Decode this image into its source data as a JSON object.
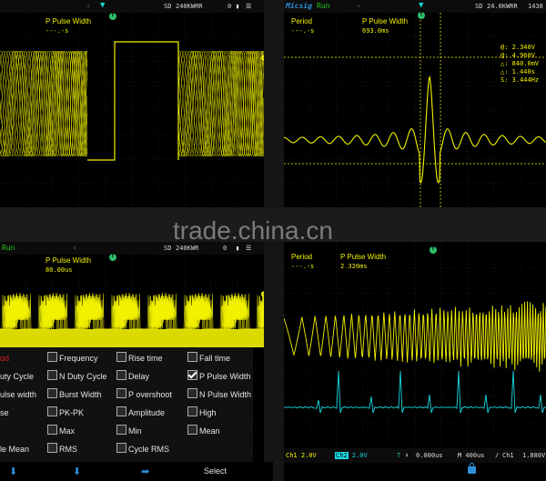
{
  "watermark": "trade.china.cn",
  "tl": {
    "topbar": {
      "sd": "SD",
      "mem": "240K",
      "mode": "WRR",
      "num": "0"
    },
    "meas": {
      "label": "P Pulse Width",
      "value": "---.-s"
    }
  },
  "tr": {
    "topbar": {
      "brand": "Micsig",
      "status": "Run",
      "sd": "SD",
      "rate": "24.0KWRR",
      "num": "1438"
    },
    "meas1": {
      "label": "Period",
      "value": "---.-s"
    },
    "meas2": {
      "label": "P Pulse Width",
      "value": "693.0ms"
    },
    "cursors": [
      "@: 2.340V",
      "@: 4.960V",
      "△: 840.0mV",
      "△: 1.440s",
      "S: 3.444Hz"
    ]
  },
  "bl": {
    "topbar": {
      "status": "Run",
      "sd": "SD",
      "mem": "240K",
      "mode": "WR",
      "num": "0"
    },
    "meas": {
      "label": "P Pulse Width",
      "value": "80.00us"
    },
    "menu": [
      {
        "label": "od",
        "checked": false,
        "red": true
      },
      {
        "label": "Frequency",
        "checked": false
      },
      {
        "label": "Rise time",
        "checked": false
      },
      {
        "label": "Fall time",
        "checked": false
      },
      {
        "label": "uty Cycle",
        "checked": false
      },
      {
        "label": "N Duty Cycle",
        "checked": false
      },
      {
        "label": "Delay",
        "checked": false
      },
      {
        "label": "P Pulse Width",
        "checked": true
      },
      {
        "label": "ulse width",
        "checked": false
      },
      {
        "label": "Burst Width",
        "checked": false
      },
      {
        "label": "P overshoot",
        "checked": false
      },
      {
        "label": "N Pulse Width",
        "checked": false
      },
      {
        "label": "se",
        "checked": false
      },
      {
        "label": "PK-PK",
        "checked": false
      },
      {
        "label": "Amplitude",
        "checked": false
      },
      {
        "label": "High",
        "checked": false
      },
      {
        "label": "",
        "checked": false
      },
      {
        "label": "Max",
        "checked": false
      },
      {
        "label": "Min",
        "checked": false
      },
      {
        "label": "Mean",
        "checked": false
      },
      {
        "label": "le Mean",
        "checked": false
      },
      {
        "label": "RMS",
        "checked": false
      },
      {
        "label": "Cycle RMS",
        "checked": false
      }
    ],
    "softkey": "Select"
  },
  "br": {
    "meas1": {
      "label": "Period",
      "value": "---.-s"
    },
    "meas2": {
      "label": "P Pulse Width",
      "value": "2.320ms"
    },
    "bottombar": {
      "ch1": "Ch1",
      "ch1v": "2.0V",
      "ch2": "Ch2",
      "ch2v": "2.0V",
      "trig": "T",
      "tpos": "0.000us",
      "timebase": "M 400us",
      "slope": "/",
      "tsrc": "Ch1",
      "tlevel": "1.880V"
    }
  },
  "colors": {
    "ch1": "#f2f200",
    "ch2": "#18d8e0",
    "accent": "#2d8fd8",
    "brand": "#2d8fd8",
    "run": "#22c822"
  }
}
